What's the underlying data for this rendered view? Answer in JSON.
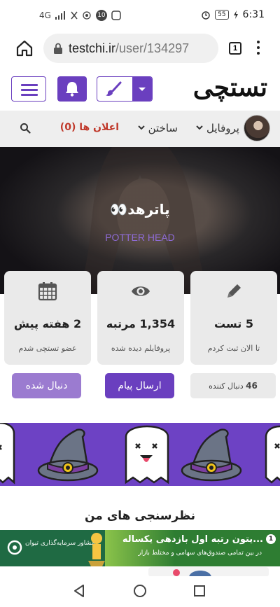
{
  "status_bar": {
    "network_label": "4G",
    "notification_count": "10",
    "battery": "55",
    "time": "6:31"
  },
  "browser": {
    "url_host": "testchi.ir",
    "url_path": "/user/134297",
    "tab_count": "1"
  },
  "header": {
    "logo": "تستچی",
    "accent_color": "#6a3fbf"
  },
  "nav": {
    "profile_label": "پروفایل",
    "build_label": "ساختن",
    "notifications_label": "اعلان ها (0)"
  },
  "hero": {
    "display_name": "پاترهد👀",
    "username": "POTTER HEAD"
  },
  "stats": [
    {
      "value": "5 تست",
      "label": "تا الان ثبت کردم",
      "icon": "pencil-icon"
    },
    {
      "value": "1,354 مرتبه",
      "label": "پروفایلم دیده شده",
      "icon": "eye-icon"
    },
    {
      "value": "2 هفته پیش",
      "label": "عضو تستچی شدم",
      "icon": "calendar-icon"
    }
  ],
  "actions": {
    "followers_count": "46",
    "followers_label": "دنبال کننده",
    "message_label": "ارسال پیام",
    "following_label": "دنبال شده"
  },
  "section": {
    "polls_title": "نظرسنجی های من"
  },
  "ad": {
    "title": "...یتون رتبه اول بازدهی یکساله",
    "subtitle": "در بین تمامی صندوق‌های سهامی و مختلط بازار",
    "logo_text": "مشاور سرمایه‌گذاری تیوان",
    "badge": "1"
  }
}
